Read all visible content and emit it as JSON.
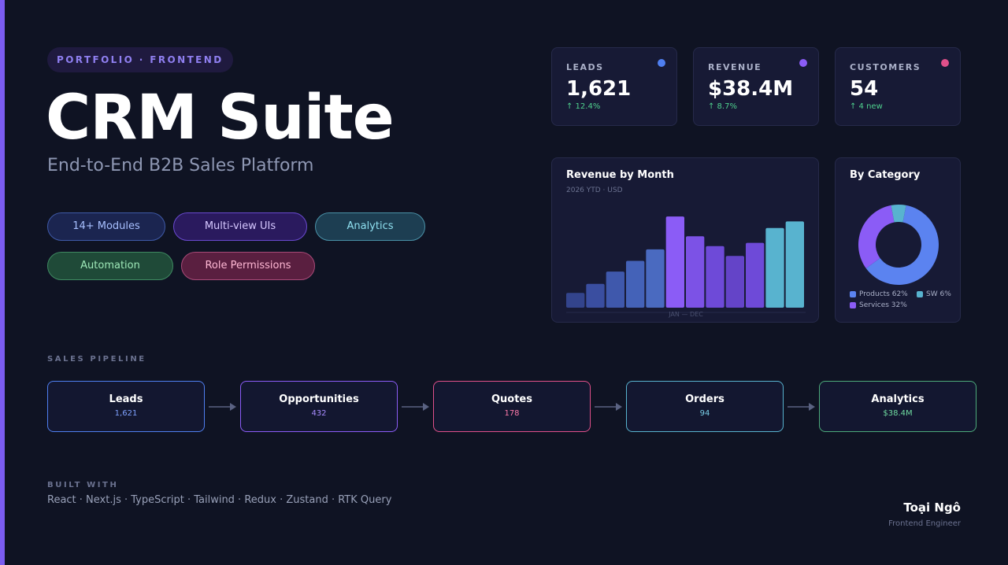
{
  "eyebrow": "PORTFOLIO · FRONTEND",
  "title": "CRM Suite",
  "subtitle": "End-to-End B2B Sales Platform",
  "pills": [
    {
      "label": "14+ Modules",
      "bg": "#1b2550",
      "border": "#3f5aa8",
      "text": "#a8c0ff"
    },
    {
      "label": "Multi-view UIs",
      "bg": "#2a1a5e",
      "border": "#6a4ad0",
      "text": "#d6c8ff"
    },
    {
      "label": "Analytics",
      "bg": "#1d3e52",
      "border": "#4a92a8",
      "text": "#8fe0f0"
    },
    {
      "label": "Automation",
      "bg": "#1f4a38",
      "border": "#3f8a62",
      "text": "#9ee8b8"
    },
    {
      "label": "Role Permissions",
      "bg": "#5a1f40",
      "border": "#a84a78",
      "text": "#ffb8d4"
    }
  ],
  "stats": [
    {
      "label": "LEADS",
      "value": "1,621",
      "delta": "↑ 12.4%",
      "dot": "#4f7ff0"
    },
    {
      "label": "REVENUE",
      "value": "$38.4M",
      "delta": "↑ 8.7%",
      "dot": "#8b5cf6"
    },
    {
      "label": "CUSTOMERS",
      "value": "54",
      "delta": "↑ 4 new",
      "dot": "#e0508a"
    }
  ],
  "revenue_chart": {
    "title": "Revenue by Month",
    "subtitle": "2026 YTD · USD",
    "axis_label": "JAN — DEC"
  },
  "category_chart": {
    "title": "By Category",
    "legend": [
      {
        "label": "Products 62%",
        "color": "#5b83f0"
      },
      {
        "label": "SW 6%",
        "color": "#58b3cf"
      },
      {
        "label": "Services 32%",
        "color": "#8b5cf6"
      }
    ]
  },
  "chart_data": [
    {
      "type": "bar",
      "title": "Revenue by Month",
      "subtitle": "2026 YTD · USD",
      "xlabel": "JAN — DEC",
      "values": [
        18,
        29,
        44,
        57,
        71,
        111,
        87,
        75,
        63,
        79,
        97,
        105
      ],
      "colors": [
        "#33448c",
        "#3a4ea0",
        "#3f58ac",
        "#4462b8",
        "#4a6ac0",
        "#8b5cf6",
        "#7c52e6",
        "#6e4ad8",
        "#6444c8",
        "#6e4ad8",
        "#58b3cf",
        "#58b3cf"
      ],
      "ylim": [
        0,
        115
      ],
      "grid": false
    },
    {
      "type": "pie",
      "title": "By Category",
      "categories": [
        "Products",
        "Services",
        "SW"
      ],
      "values": [
        62,
        32,
        6
      ],
      "colors": [
        "#5b83f0",
        "#8b5cf6",
        "#58b3cf"
      ]
    }
  ],
  "pipeline": {
    "label": "SALES PIPELINE",
    "stages": [
      {
        "name": "Leads",
        "count": "1,621",
        "color": "#4f7ff0",
        "count_color": "#7fa2ff"
      },
      {
        "name": "Opportunities",
        "count": "432",
        "color": "#8b5cf6",
        "count_color": "#a88cff"
      },
      {
        "name": "Quotes",
        "count": "178",
        "color": "#e0508a",
        "count_color": "#ff7aaa"
      },
      {
        "name": "Orders",
        "count": "94",
        "color": "#58b3cf",
        "count_color": "#7ad0e8"
      },
      {
        "name": "Analytics",
        "count": "$38.4M",
        "color": "#4caa7a",
        "count_color": "#6fdca0"
      }
    ]
  },
  "built_with": {
    "label": "BUILT WITH",
    "stack": "React · Next.js · TypeScript · Tailwind · Redux · Zustand · RTK Query"
  },
  "author": {
    "name": "Toại Ngô",
    "role": "Frontend Engineer"
  }
}
